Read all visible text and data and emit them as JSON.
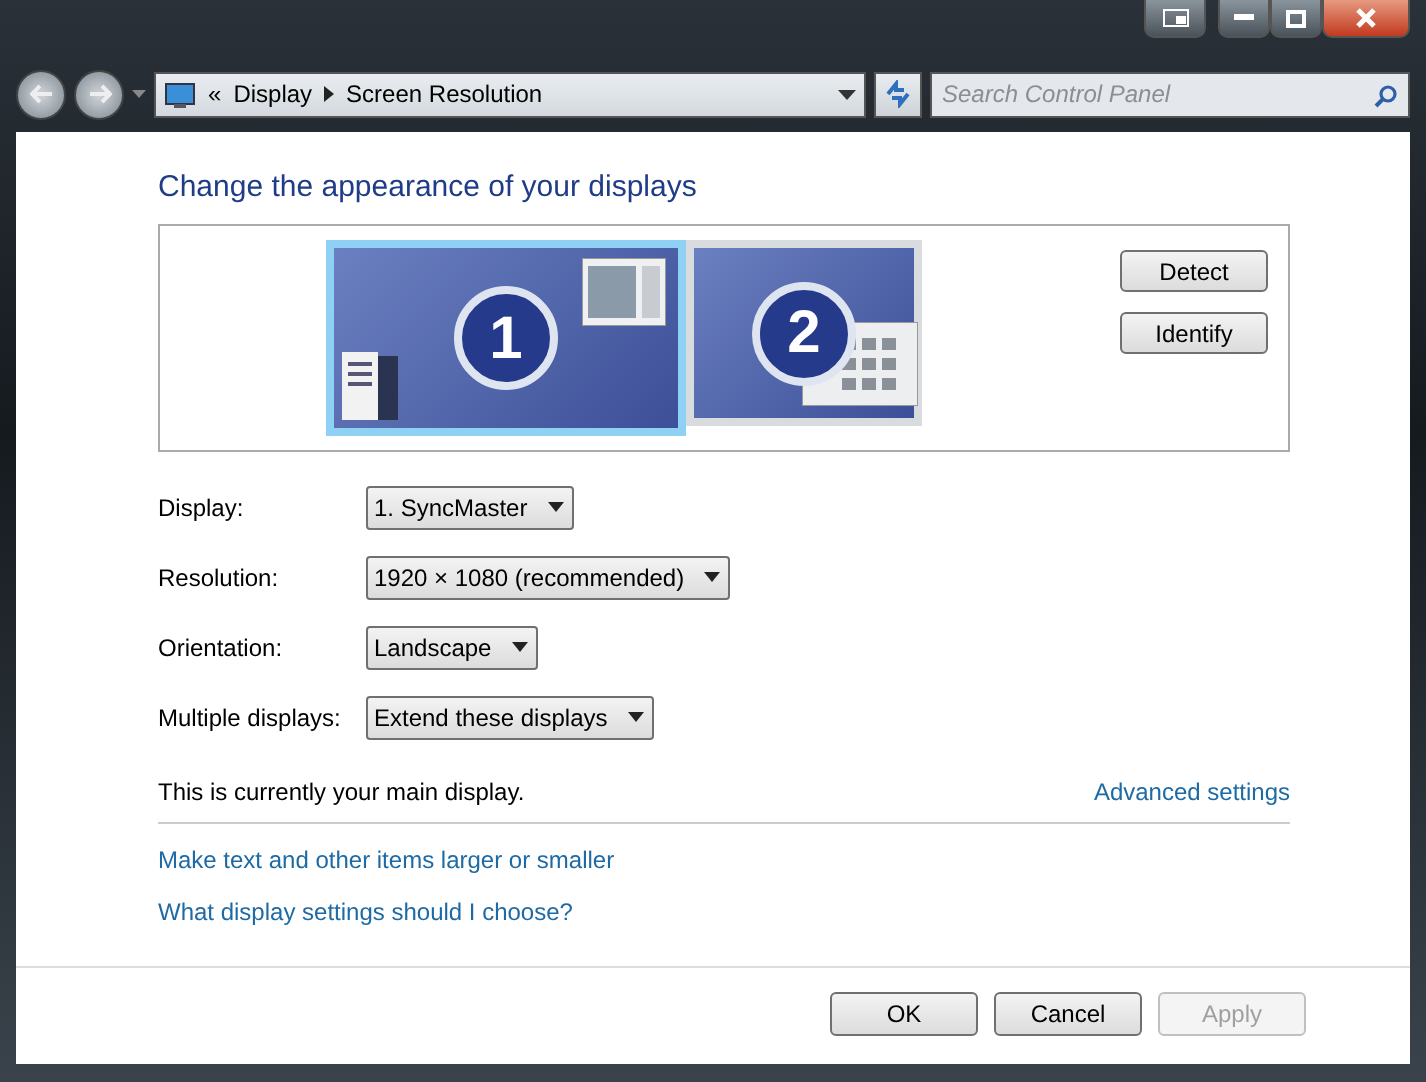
{
  "address_bar": {
    "overflow_mark": "«",
    "crumbs": [
      "Display",
      "Screen Resolution"
    ]
  },
  "search": {
    "placeholder": "Search Control Panel"
  },
  "heading": "Change the appearance of your displays",
  "monitors": [
    {
      "number": "1",
      "selected": true
    },
    {
      "number": "2",
      "selected": false
    }
  ],
  "monitor_buttons": [
    "Detect",
    "Identify"
  ],
  "settings": [
    {
      "label": "Display:",
      "value": "1. SyncMaster"
    },
    {
      "label": "Resolution:",
      "value": "1920 × 1080 (recommended)"
    },
    {
      "label": "Orientation:",
      "value": "Landscape"
    },
    {
      "label": "Multiple displays:",
      "value": "Extend these displays"
    }
  ],
  "main_display_note": "This is currently your main display.",
  "advanced_link": "Advanced settings",
  "links": [
    "Make text and other items larger or smaller",
    "What display settings should I choose?"
  ],
  "buttons": [
    {
      "label": "OK",
      "disabled": false
    },
    {
      "label": "Cancel",
      "disabled": false
    },
    {
      "label": "Apply",
      "disabled": true
    }
  ]
}
